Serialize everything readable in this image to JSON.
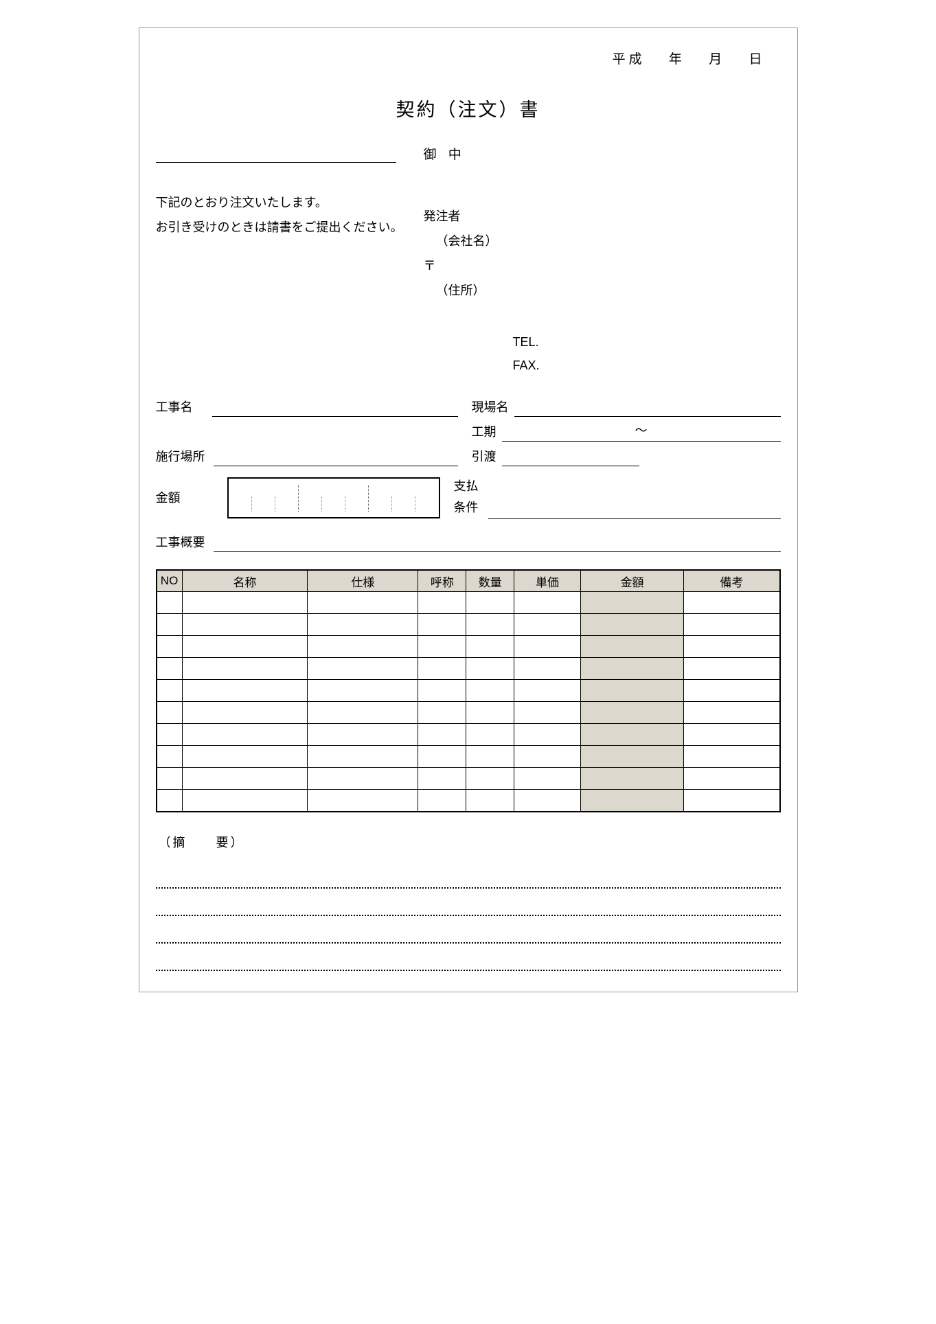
{
  "date": {
    "era": "平成",
    "year": "年",
    "month": "月",
    "day": "日"
  },
  "title": "契約（注文）書",
  "onchu": "御  中",
  "notice_line1": "下記のとおり注文いたします。",
  "notice_line2": "お引き受けのときは請書をご提出ください。",
  "orderer": {
    "label": "発注者",
    "company": "（会社名）",
    "postal": "〒",
    "address": "（住所）"
  },
  "contact": {
    "tel": "TEL.",
    "fax": "FAX."
  },
  "fields": {
    "kouji": "工事名",
    "genba": "現場名",
    "kouki": "工期",
    "kouki_tilde": "～",
    "sekou": "施行場所",
    "hikiwatashi": "引渡",
    "kingaku": "金額",
    "shiharai": "支払",
    "jouken": "条件",
    "gaiyou": "工事概要"
  },
  "table": {
    "headers": [
      "NO",
      "名称",
      "仕様",
      "呼称",
      "数量",
      "単価",
      "金額",
      "備考"
    ],
    "row_count": 10
  },
  "notes_label": "（摘　　要）",
  "notes_line_count": 4
}
